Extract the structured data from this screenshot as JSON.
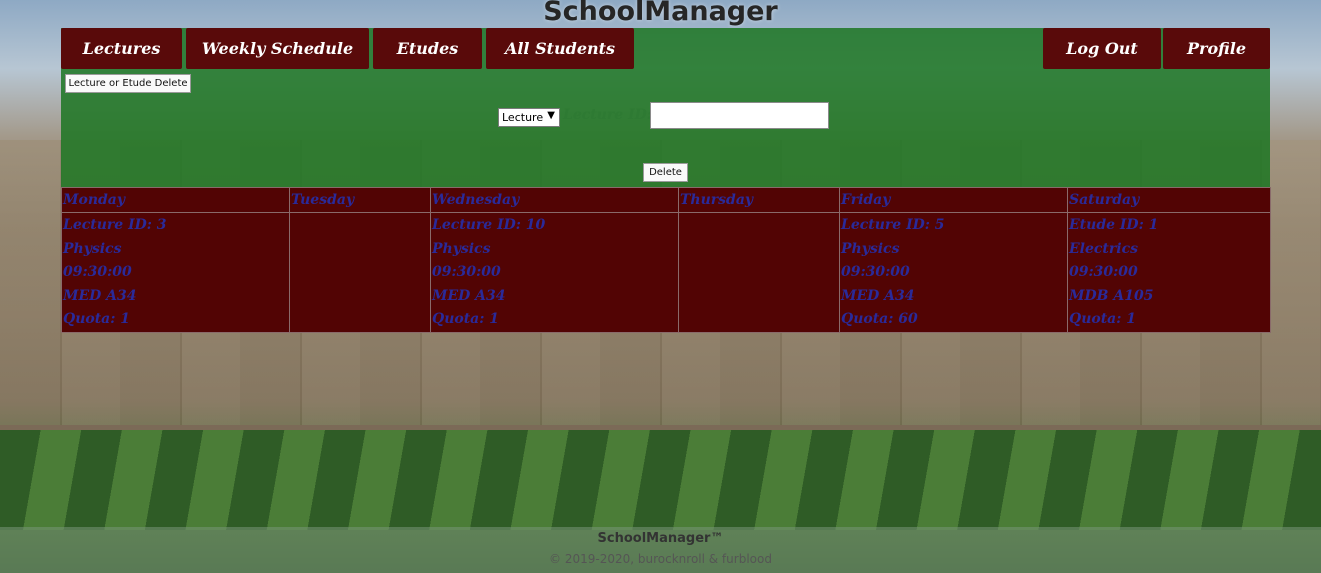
{
  "site": {
    "title": "SchoolManager"
  },
  "nav": {
    "lectures": "Lectures",
    "weekly_schedule": "Weekly Schedule",
    "etudes": "Etudes",
    "all_students": "All Students",
    "log_out": "Log Out",
    "profile": "Profile"
  },
  "delete_form": {
    "mode_button": "Lecture or Etude Delete",
    "type_select_value": "Lecture",
    "id_label": "Lecture ID:",
    "id_value": "",
    "submit": "Delete"
  },
  "schedule": {
    "days": [
      "Monday",
      "Tuesday",
      "Wednesday",
      "Thursday",
      "Friday",
      "Saturday"
    ],
    "entries": [
      [
        "Lecture ID: 3",
        "Physics",
        "09:30:00",
        "MED A34",
        "Quota: 1"
      ],
      [
        "",
        "",
        "",
        "",
        ""
      ],
      [
        "Lecture ID: 10",
        "Physics",
        "09:30:00",
        "MED A34",
        "Quota: 1"
      ],
      [
        "",
        "",
        "",
        "",
        ""
      ],
      [
        "Lecture ID: 5",
        "Physics",
        "09:30:00",
        "MED A34",
        "Quota: 60"
      ],
      [
        "Etude ID: 1",
        "Electrics",
        "09:30:00",
        "MDB A105",
        "Quota: 1"
      ]
    ]
  },
  "footer": {
    "brand": "SchoolManager™",
    "copyright": "© 2019-2020, burocknroll & furblood"
  }
}
